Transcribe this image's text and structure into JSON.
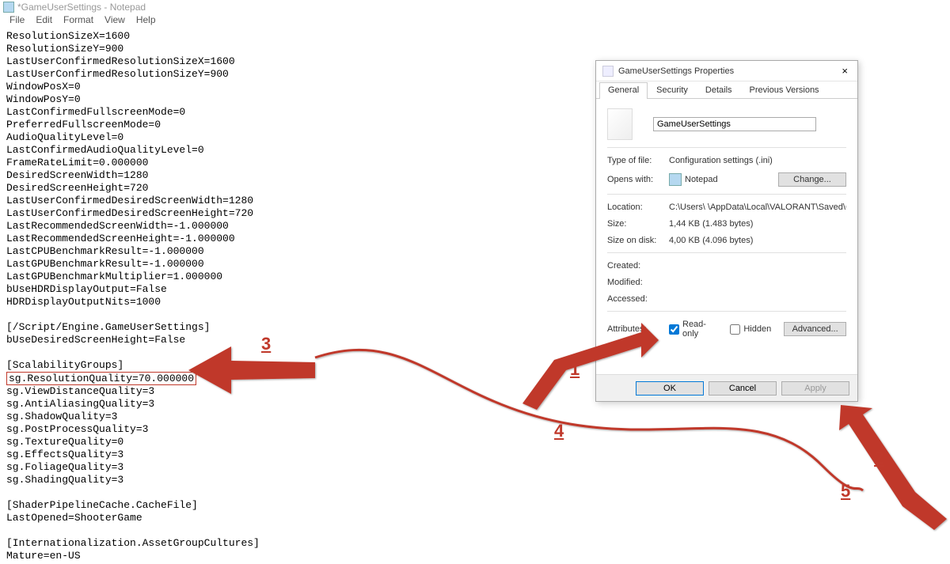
{
  "window": {
    "title": "*GameUserSettings - Notepad"
  },
  "menu": {
    "file": "File",
    "edit": "Edit",
    "format": "Format",
    "view": "View",
    "help": "Help"
  },
  "editor": {
    "lines": [
      "ResolutionSizeX=1600",
      "ResolutionSizeY=900",
      "LastUserConfirmedResolutionSizeX=1600",
      "LastUserConfirmedResolutionSizeY=900",
      "WindowPosX=0",
      "WindowPosY=0",
      "LastConfirmedFullscreenMode=0",
      "PreferredFullscreenMode=0",
      "AudioQualityLevel=0",
      "LastConfirmedAudioQualityLevel=0",
      "FrameRateLimit=0.000000",
      "DesiredScreenWidth=1280",
      "DesiredScreenHeight=720",
      "LastUserConfirmedDesiredScreenWidth=1280",
      "LastUserConfirmedDesiredScreenHeight=720",
      "LastRecommendedScreenWidth=-1.000000",
      "LastRecommendedScreenHeight=-1.000000",
      "LastCPUBenchmarkResult=-1.000000",
      "LastGPUBenchmarkResult=-1.000000",
      "LastGPUBenchmarkMultiplier=1.000000",
      "bUseHDRDisplayOutput=False",
      "HDRDisplayOutputNits=1000",
      "",
      "[/Script/Engine.GameUserSettings]",
      "bUseDesiredScreenHeight=False",
      "",
      "[ScalabilityGroups]",
      "sg.ResolutionQuality=70.000000",
      "sg.ViewDistanceQuality=3",
      "sg.AntiAliasingQuality=3",
      "sg.ShadowQuality=3",
      "sg.PostProcessQuality=3",
      "sg.TextureQuality=0",
      "sg.EffectsQuality=3",
      "sg.FoliageQuality=3",
      "sg.ShadingQuality=3",
      "",
      "[ShaderPipelineCache.CacheFile]",
      "LastOpened=ShooterGame",
      "",
      "[Internationalization.AssetGroupCultures]",
      "Mature=en-US"
    ],
    "highlight_index": 27
  },
  "dialog": {
    "title": "GameUserSettings Properties",
    "close": "×",
    "tabs": {
      "general": "General",
      "security": "Security",
      "details": "Details",
      "previous": "Previous Versions"
    },
    "filename": "GameUserSettings",
    "type_label": "Type of file:",
    "type_value": "Configuration settings (.ini)",
    "opens_label": "Opens with:",
    "opens_value": "Notepad",
    "change": "Change...",
    "location_label": "Location:",
    "location_value": "C:\\Users\\     \\AppData\\Local\\VALORANT\\Saved\\Con",
    "size_label": "Size:",
    "size_value": "1,44 KB (1.483 bytes)",
    "disk_label": "Size on disk:",
    "disk_value": "4,00 KB (4.096 bytes)",
    "created_label": "Created:",
    "modified_label": "Modified:",
    "accessed_label": "Accessed:",
    "attributes_label": "Attributes:",
    "readonly": "Read-only",
    "hidden": "Hidden",
    "advanced": "Advanced...",
    "ok": "OK",
    "cancel": "Cancel",
    "apply": "Apply"
  },
  "annotations": {
    "n1": "1",
    "n2": "2",
    "n3": "3",
    "n4": "4",
    "n5": "5"
  },
  "colors": {
    "accent": "#c0392b"
  }
}
